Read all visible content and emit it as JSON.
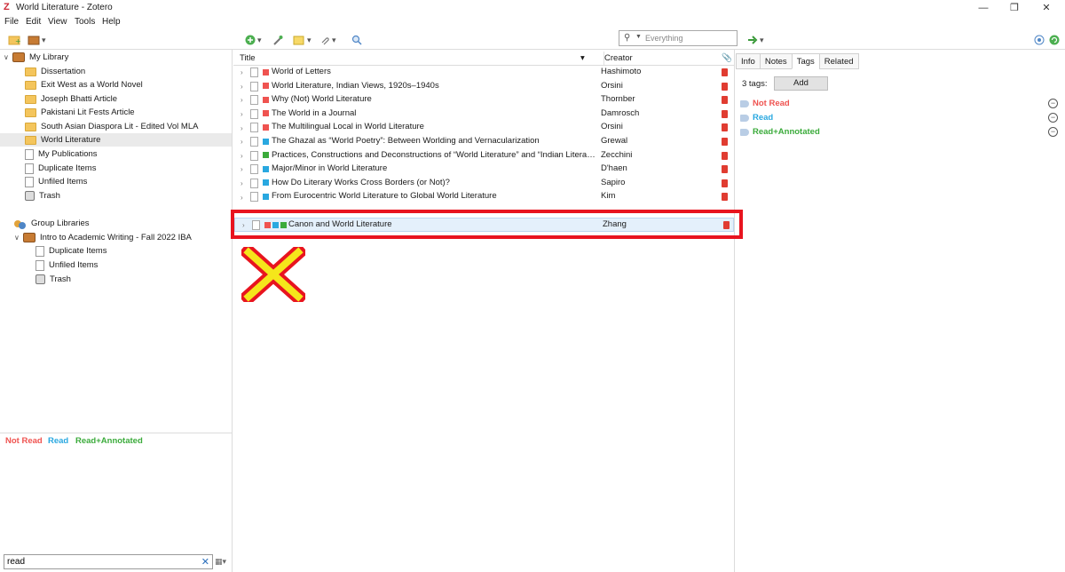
{
  "window": {
    "title": "World Literature - Zotero",
    "app_icon_letter": "Z"
  },
  "menu": [
    "File",
    "Edit",
    "View",
    "Tools",
    "Help"
  ],
  "search": {
    "placeholder": "Everything"
  },
  "library_tree": {
    "my_library": "My Library",
    "collections": [
      "Dissertation",
      "Exit West as a World Novel",
      "Joseph Bhatti Article",
      "Pakistani Lit Fests Article",
      "South Asian Diaspora Lit - Edited Vol MLA",
      "World Literature"
    ],
    "selected_collection": "World Literature",
    "my_publications": "My Publications",
    "duplicate_items": "Duplicate Items",
    "unfiled_items": "Unfiled Items",
    "trash": "Trash",
    "group_libraries": "Group Libraries",
    "group": {
      "name": "Intro to Academic Writing - Fall 2022 IBA",
      "duplicate_items": "Duplicate Items",
      "unfiled_items": "Unfiled Items",
      "trash": "Trash"
    }
  },
  "tag_selector": {
    "tags": [
      {
        "name": "Not Read",
        "color": "#ef5350"
      },
      {
        "name": "Read",
        "color": "#29a8e0"
      },
      {
        "name": "Read+Annotated",
        "color": "#3bab3b"
      }
    ],
    "filter_value": "read"
  },
  "items_table": {
    "columns": [
      "Title",
      "Creator"
    ],
    "rows": [
      {
        "title": "World of Letters",
        "creator": "Hashimoto",
        "tag_colors": [
          "#ef5350"
        ]
      },
      {
        "title": "World Literature, Indian Views, 1920s–1940s",
        "creator": "Orsini",
        "tag_colors": [
          "#ef5350"
        ]
      },
      {
        "title": "Why (Not) World Literature",
        "creator": "Thornber",
        "tag_colors": [
          "#ef5350"
        ]
      },
      {
        "title": "The World in a Journal",
        "creator": "Damrosch",
        "tag_colors": [
          "#ef5350"
        ]
      },
      {
        "title": "The Multilingual Local in World Literature",
        "creator": "Orsini",
        "tag_colors": [
          "#ef5350"
        ]
      },
      {
        "title": "The Ghazal as “World Poetry”: Between Worlding and Vernacularization",
        "creator": "Grewal",
        "tag_colors": [
          "#29a8e0"
        ]
      },
      {
        "title": "Practices, Constructions and Deconstructions of “World Literature” and “Indian Literatu…",
        "creator": "Zecchini",
        "tag_colors": [
          "#3bab3b"
        ]
      },
      {
        "title": "Major/Minor in World Literature",
        "creator": "D'haen",
        "tag_colors": [
          "#29a8e0"
        ]
      },
      {
        "title": "How Do Literary Works Cross Borders (or Not)?",
        "creator": "Sapiro",
        "tag_colors": [
          "#29a8e0"
        ]
      },
      {
        "title": "From Eurocentric World Literature to Global World Literature",
        "creator": "Kim",
        "tag_colors": [
          "#29a8e0"
        ]
      }
    ],
    "highlighted_row": {
      "title": "Canon and World Literature",
      "creator": "Zhang",
      "tag_colors": [
        "#ef5350",
        "#29a8e0",
        "#3bab3b"
      ]
    }
  },
  "item_pane": {
    "tabs": [
      "Info",
      "Notes",
      "Tags",
      "Related"
    ],
    "active_tab": "Tags",
    "tags_count_label": "3 tags:",
    "add_label": "Add",
    "tags": [
      {
        "name": "Not Read",
        "color": "#ef5350"
      },
      {
        "name": "Read",
        "color": "#29a8e0"
      },
      {
        "name": "Read+Annotated",
        "color": "#3bab3b"
      }
    ]
  },
  "annotations": {
    "red_box_color": "#e8141f",
    "x_mark_colors": [
      "#e8141f",
      "#f5e61b"
    ]
  }
}
